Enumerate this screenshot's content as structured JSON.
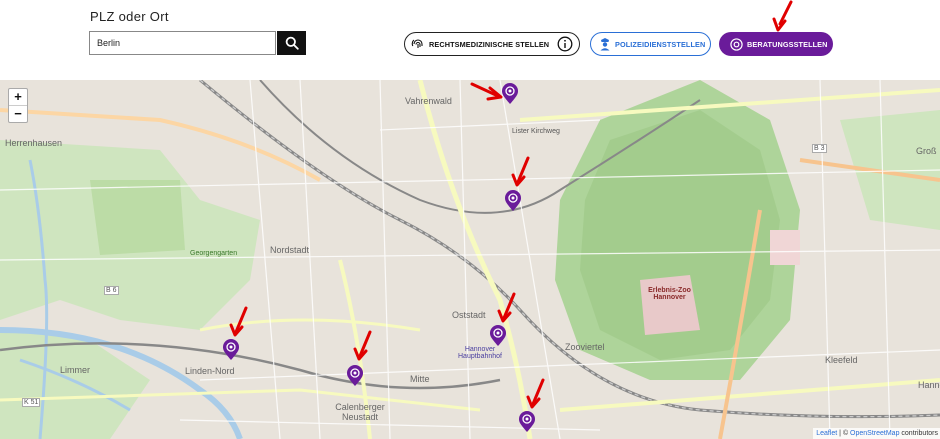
{
  "search": {
    "label": "PLZ oder Ort",
    "value": "Berlin"
  },
  "filters": {
    "rechtsmedizin": "RECHTSMEDIZINISCHE STELLEN",
    "polizei": "POLIZEIDIENSTSTELLEN",
    "beratung": "BERATUNGSSTELLEN"
  },
  "colors": {
    "accent_purple": "#6a1b9a",
    "police_blue": "#2a6fd6",
    "annotation_red": "#e00000"
  },
  "map": {
    "zoom_in": "+",
    "zoom_out": "−",
    "labels": {
      "vahrenwald": "Vahrenwald",
      "herrenhausen": "Herrenhausen",
      "nordstadt": "Nordstadt",
      "oststadt": "Oststadt",
      "mitte": "Mitte",
      "zooviertel": "Zooviertel",
      "calenberger": "Calenberger Neustadt",
      "linden_nord": "Linden-Nord",
      "limmer": "Limmer",
      "kleefeld": "Kleefeld",
      "hauptbahnhof": "Hannover Hauptbahnhof",
      "zoo": "Erlebnis-Zoo Hannover",
      "georgengarten": "Georgengarten",
      "lister_kirchweg": "Lister Kirchweg",
      "b3": "B 3",
      "b6": "B 6",
      "k51": "K 51",
      "hannover_right": "Hanno",
      "gross": "Groß"
    },
    "attribution": {
      "leaflet": "Leaflet",
      "separator": " | © ",
      "osm": "OpenStreetMap",
      "contributors": " contributors"
    }
  },
  "markers": [
    {
      "name": "beratungsstelle-marker-1"
    },
    {
      "name": "beratungsstelle-marker-2"
    },
    {
      "name": "beratungsstelle-marker-3"
    },
    {
      "name": "beratungsstelle-marker-4"
    },
    {
      "name": "beratungsstelle-marker-5"
    },
    {
      "name": "beratungsstelle-marker-6"
    }
  ]
}
